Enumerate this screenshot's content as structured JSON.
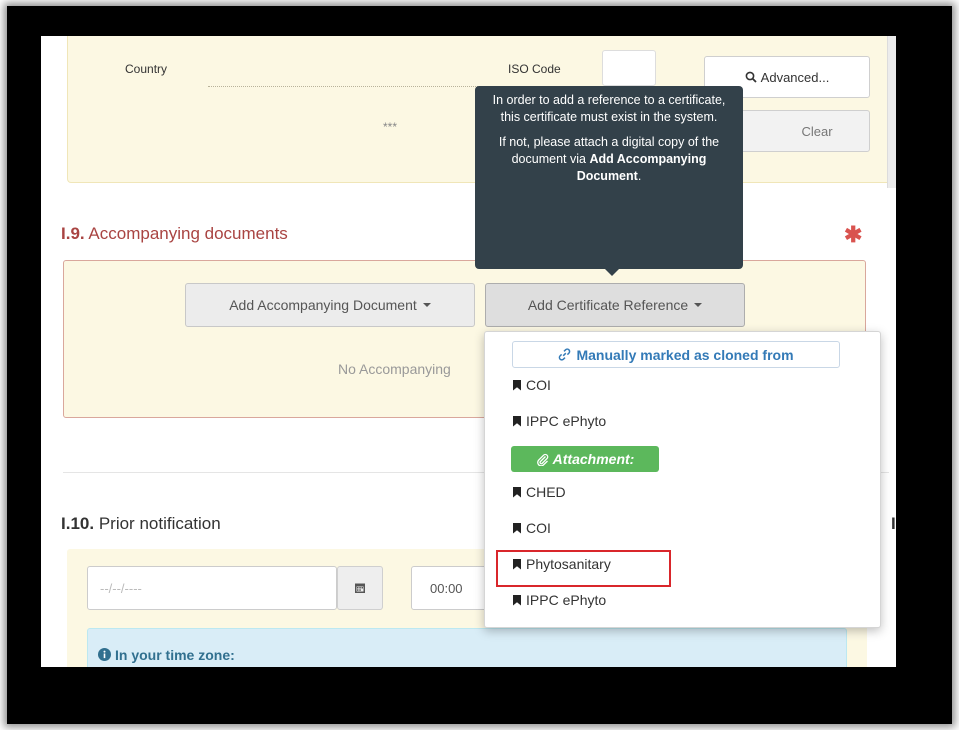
{
  "address": {
    "country_label": "Country",
    "iso_label": "ISO Code",
    "ellipsis": "***",
    "advanced_button": "Advanced...",
    "clear_button": "Clear"
  },
  "tooltip": {
    "line1": "In order to add a reference to a certificate, this certificate must exist in the system.",
    "line2_prefix": "If not, please attach a digital copy of the document via",
    "line2_bold": "Add Accompanying Document",
    "line2_suffix": "."
  },
  "accompanying": {
    "number": "I.9.",
    "title": "Accompanying documents",
    "required_mark": "✱",
    "add_doc_button": "Add Accompanying Document",
    "add_cert_button": "Add Certificate Reference",
    "empty_text": "No Accompanying"
  },
  "menu": {
    "cloned_header": "Manually marked as cloned from",
    "cloned_items": [
      "COI",
      "IPPC ePhyto"
    ],
    "attachment_header": "Attachment:",
    "attachment_items": [
      "CHED",
      "COI",
      "Phytosanitary",
      "IPPC ePhyto"
    ]
  },
  "prior": {
    "number": "I.10.",
    "title": "Prior notification",
    "date_placeholder": "--/--/----",
    "time_value": "00:00",
    "timezone_label": "In your time zone:",
    "next_section_number": "I."
  },
  "colors": {
    "panel": "#fcf8e3",
    "error": "#a94442",
    "required": "#d9534f",
    "tooltip": "#33414a",
    "link": "#337ab7",
    "success": "#5cb85c",
    "highlight": "#d9262b",
    "info": "#d9edf7"
  }
}
